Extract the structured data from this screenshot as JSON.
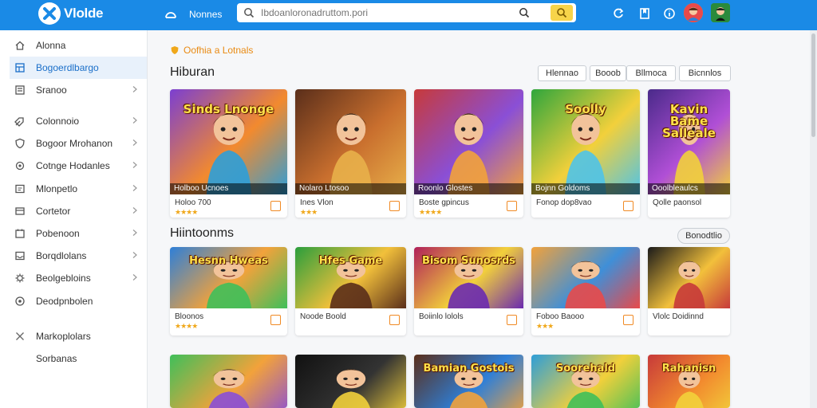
{
  "app": {
    "name": "Vlolde"
  },
  "topbar": {
    "nav_label": "Nonnes",
    "search_placeholder": "Ibdoanloronadruttom.pori",
    "icons": [
      "home-icon",
      "refresh-icon",
      "bookmark-icon",
      "info-icon"
    ]
  },
  "sidebar": {
    "items": [
      {
        "label": "Alonna",
        "icon": "home-icon",
        "active": false,
        "chevron": false
      },
      {
        "label": "Bogoerdlbargo",
        "icon": "grid-icon",
        "active": true,
        "chevron": false
      },
      {
        "label": "Sranoo",
        "icon": "list-icon",
        "active": false,
        "chevron": true
      },
      {
        "label": "Colonnoio",
        "icon": "tag-icon",
        "active": false,
        "chevron": true
      },
      {
        "label": "Bogoor Mrohanon",
        "icon": "shield-icon",
        "active": false,
        "chevron": true
      },
      {
        "label": "Cotnge Hodanles",
        "icon": "settings-icon",
        "active": false,
        "chevron": true
      },
      {
        "label": "Mlonpetlo",
        "icon": "folder-icon",
        "active": false,
        "chevron": true
      },
      {
        "label": "Cortetor",
        "icon": "box-icon",
        "active": false,
        "chevron": true
      },
      {
        "label": "Pobenoon",
        "icon": "calendar-icon",
        "active": false,
        "chevron": true
      },
      {
        "label": "Borqdlolans",
        "icon": "inbox-icon",
        "active": false,
        "chevron": true
      },
      {
        "label": "Beolgebloins",
        "icon": "gear-icon",
        "active": false,
        "chevron": true
      },
      {
        "label": "Deodpnbolen",
        "icon": "circle-icon",
        "active": false,
        "chevron": false
      },
      {
        "label": "Markoplolars",
        "icon": "close-icon",
        "active": false,
        "chevron": false
      },
      {
        "label": "Sorbanas",
        "icon": "",
        "active": false,
        "chevron": false
      }
    ]
  },
  "breadcrumb": {
    "label": "Oofhia a Lotnals"
  },
  "sections": [
    {
      "title": "Hiburan",
      "filters": [
        "Hlennao",
        "Booob",
        "Bllmoca",
        "Bicnnlos"
      ],
      "cards": [
        {
          "caption": "Holboo Ucnoes",
          "sub": "Holoo 700",
          "stars": "★★★★",
          "art": "Sinds Lnonge",
          "palette": [
            "#7b3fd1",
            "#f28a2e",
            "#2e9ed8"
          ]
        },
        {
          "caption": "Nolaro Ltosoo",
          "sub": "Ines Vlon",
          "stars": "★★★",
          "art": "",
          "palette": [
            "#5a2e1a",
            "#c96f2e",
            "#e8b04a"
          ]
        },
        {
          "caption": "Roonlo Glostes",
          "sub": "Boste gpincus",
          "stars": "★★★★",
          "art": "",
          "palette": [
            "#c73a3a",
            "#8a4fd6",
            "#f2a23b"
          ]
        },
        {
          "caption": "Bojnn Goldoms",
          "sub": "Fonop dop8vao",
          "stars": "",
          "art": "Soolly",
          "palette": [
            "#2fa63c",
            "#f2d03b",
            "#4fc3e8"
          ]
        },
        {
          "caption": "Ooolbleaulcs",
          "sub": "Qolle paonsol",
          "stars": "",
          "art": "Kavin Bame Salleale",
          "palette": [
            "#4a2a8a",
            "#b04fd6",
            "#f2d03b"
          ]
        }
      ]
    },
    {
      "title": "Hiintoonms",
      "filters": [
        "Bonodtlio"
      ],
      "cards": [
        {
          "caption": "",
          "sub": "Bloonos",
          "stars": "★★★★",
          "art": "Hesnn Hweas",
          "palette": [
            "#2e7fd8",
            "#f2a23b",
            "#3fbf5a"
          ]
        },
        {
          "caption": "",
          "sub": "Noode Boold",
          "stars": "",
          "art": "Hfes Game",
          "palette": [
            "#2a9e3c",
            "#f2c03b",
            "#5a2e1a"
          ]
        },
        {
          "caption": "",
          "sub": "Boiinlo lolols",
          "stars": "",
          "art": "Bisom Sunosrds",
          "palette": [
            "#b0205a",
            "#f2d03b",
            "#6a2ab0"
          ]
        },
        {
          "caption": "",
          "sub": "Foboo Baooo",
          "stars": "★★★",
          "art": "",
          "palette": [
            "#f2a23b",
            "#3f8fd8",
            "#e84a4a"
          ]
        },
        {
          "caption": "",
          "sub": "Vlolc Doidinnd",
          "stars": "",
          "art": "",
          "palette": [
            "#1a1a1a",
            "#f2c03b",
            "#c73a3a"
          ]
        }
      ]
    },
    {
      "title": "",
      "filters": [],
      "cards": [
        {
          "caption": "",
          "sub": "",
          "stars": "",
          "art": "",
          "palette": [
            "#3fbf5a",
            "#f2a23b",
            "#8a4fd6"
          ]
        },
        {
          "caption": "",
          "sub": "",
          "stars": "",
          "art": "",
          "palette": [
            "#111111",
            "#333333",
            "#f2d03b"
          ]
        },
        {
          "caption": "",
          "sub": "",
          "stars": "",
          "art": "Bamian Gostois",
          "palette": [
            "#5a2e1a",
            "#2e7fd8",
            "#f2a23b"
          ]
        },
        {
          "caption": "",
          "sub": "",
          "stars": "",
          "art": "Soorehald",
          "palette": [
            "#2e9ed8",
            "#f2d03b",
            "#3fbf5a"
          ]
        },
        {
          "caption": "",
          "sub": "",
          "stars": "",
          "art": "Rahanisn",
          "palette": [
            "#c73a3a",
            "#f28a2e",
            "#f2d03b"
          ]
        }
      ]
    }
  ]
}
